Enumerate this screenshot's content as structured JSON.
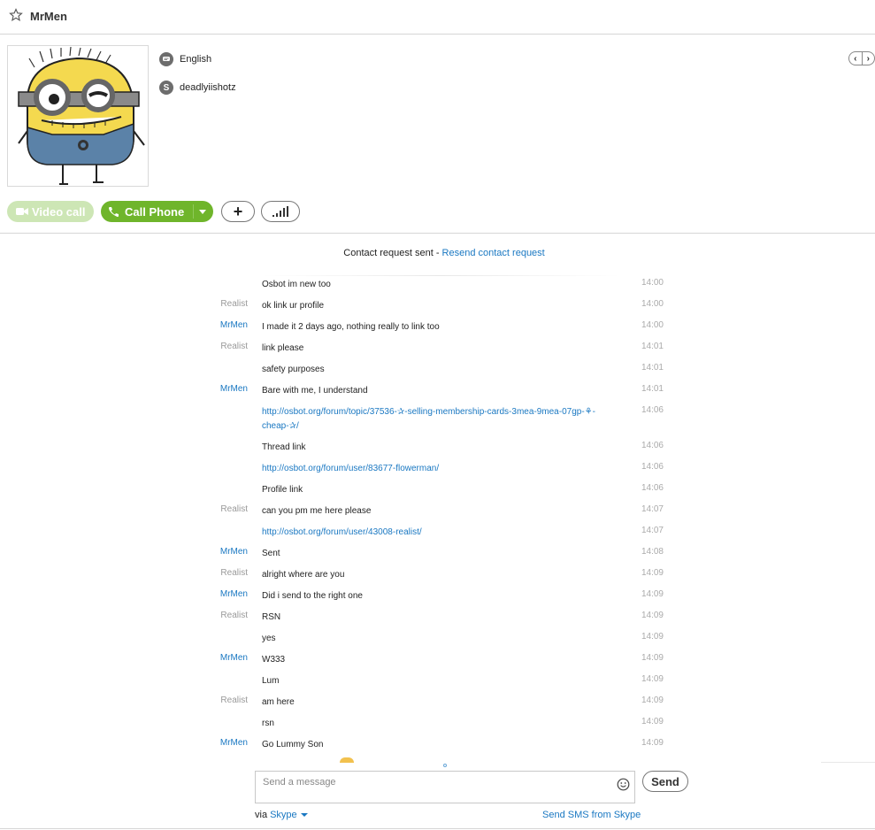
{
  "header": {
    "contact_name": "MrMen"
  },
  "profile": {
    "language": "English",
    "skype_name": "deadlyiishotz"
  },
  "actions": {
    "video_call": "Video call",
    "call_phone": "Call Phone",
    "add": "+"
  },
  "conversation": {
    "request_sent": "Contact request sent - ",
    "resend_link": "Resend contact request",
    "messages": [
      {
        "sender": "",
        "text": "Osbot im new too",
        "time": "14:00"
      },
      {
        "sender": "Realist",
        "text": "ok link ur profile",
        "time": "14:00"
      },
      {
        "sender": "MrMen",
        "text": "I made it 2 days ago, nothing really to link too",
        "time": "14:00"
      },
      {
        "sender": "Realist",
        "text": "link please",
        "time": "14:01"
      },
      {
        "sender": "",
        "text": "safety purposes",
        "time": "14:01"
      },
      {
        "sender": "MrMen",
        "text": "Bare with me, I understand",
        "time": "14:01"
      },
      {
        "sender": "",
        "text": "http://osbot.org/forum/topic/37536-✰-selling-membership-cards-3mea-9mea-07gp-⚘-cheap-✰/",
        "time": "14:06"
      },
      {
        "sender": "",
        "text": "Thread link",
        "time": "14:06"
      },
      {
        "sender": "",
        "text": "http://osbot.org/forum/user/83677-flowerman/",
        "time": "14:06"
      },
      {
        "sender": "",
        "text": "Profile link",
        "time": "14:06"
      },
      {
        "sender": "Realist",
        "text": "can you pm me here please",
        "time": "14:07"
      },
      {
        "sender": "",
        "text": "http://osbot.org/forum/user/43008-realist/",
        "time": "14:07"
      },
      {
        "sender": "MrMen",
        "text": "Sent",
        "time": "14:08"
      },
      {
        "sender": "Realist",
        "text": "alright where are you",
        "time": "14:09"
      },
      {
        "sender": "MrMen",
        "text": "Did i send to the right one",
        "time": "14:09"
      },
      {
        "sender": "Realist",
        "text": "RSN",
        "time": "14:09"
      },
      {
        "sender": "",
        "text": "yes",
        "time": "14:09"
      },
      {
        "sender": "MrMen",
        "text": "W333",
        "time": "14:09"
      },
      {
        "sender": "",
        "text": "Lum",
        "time": "14:09"
      },
      {
        "sender": "Realist",
        "text": "am here",
        "time": "14:09"
      },
      {
        "sender": "",
        "text": "rsn",
        "time": "14:09"
      },
      {
        "sender": "MrMen",
        "text": "Go Lummy Son",
        "time": "14:09"
      }
    ]
  },
  "compose": {
    "placeholder": "Send a message",
    "send_label": "Send",
    "via_label": "via",
    "via_service": "Skype",
    "sms_link": "Send SMS from Skype"
  },
  "colors": {
    "accent": "#1a78c2",
    "call_green": "#6fb52b",
    "video_green_disabled": "#cde6b5"
  },
  "icons": {
    "favorite": "star-icon",
    "language": "chat-bubble-icon",
    "skype": "skype-icon",
    "video": "video-camera-icon",
    "phone": "phone-icon",
    "signal": "signal-bars-icon",
    "emoji": "smiley-icon"
  }
}
